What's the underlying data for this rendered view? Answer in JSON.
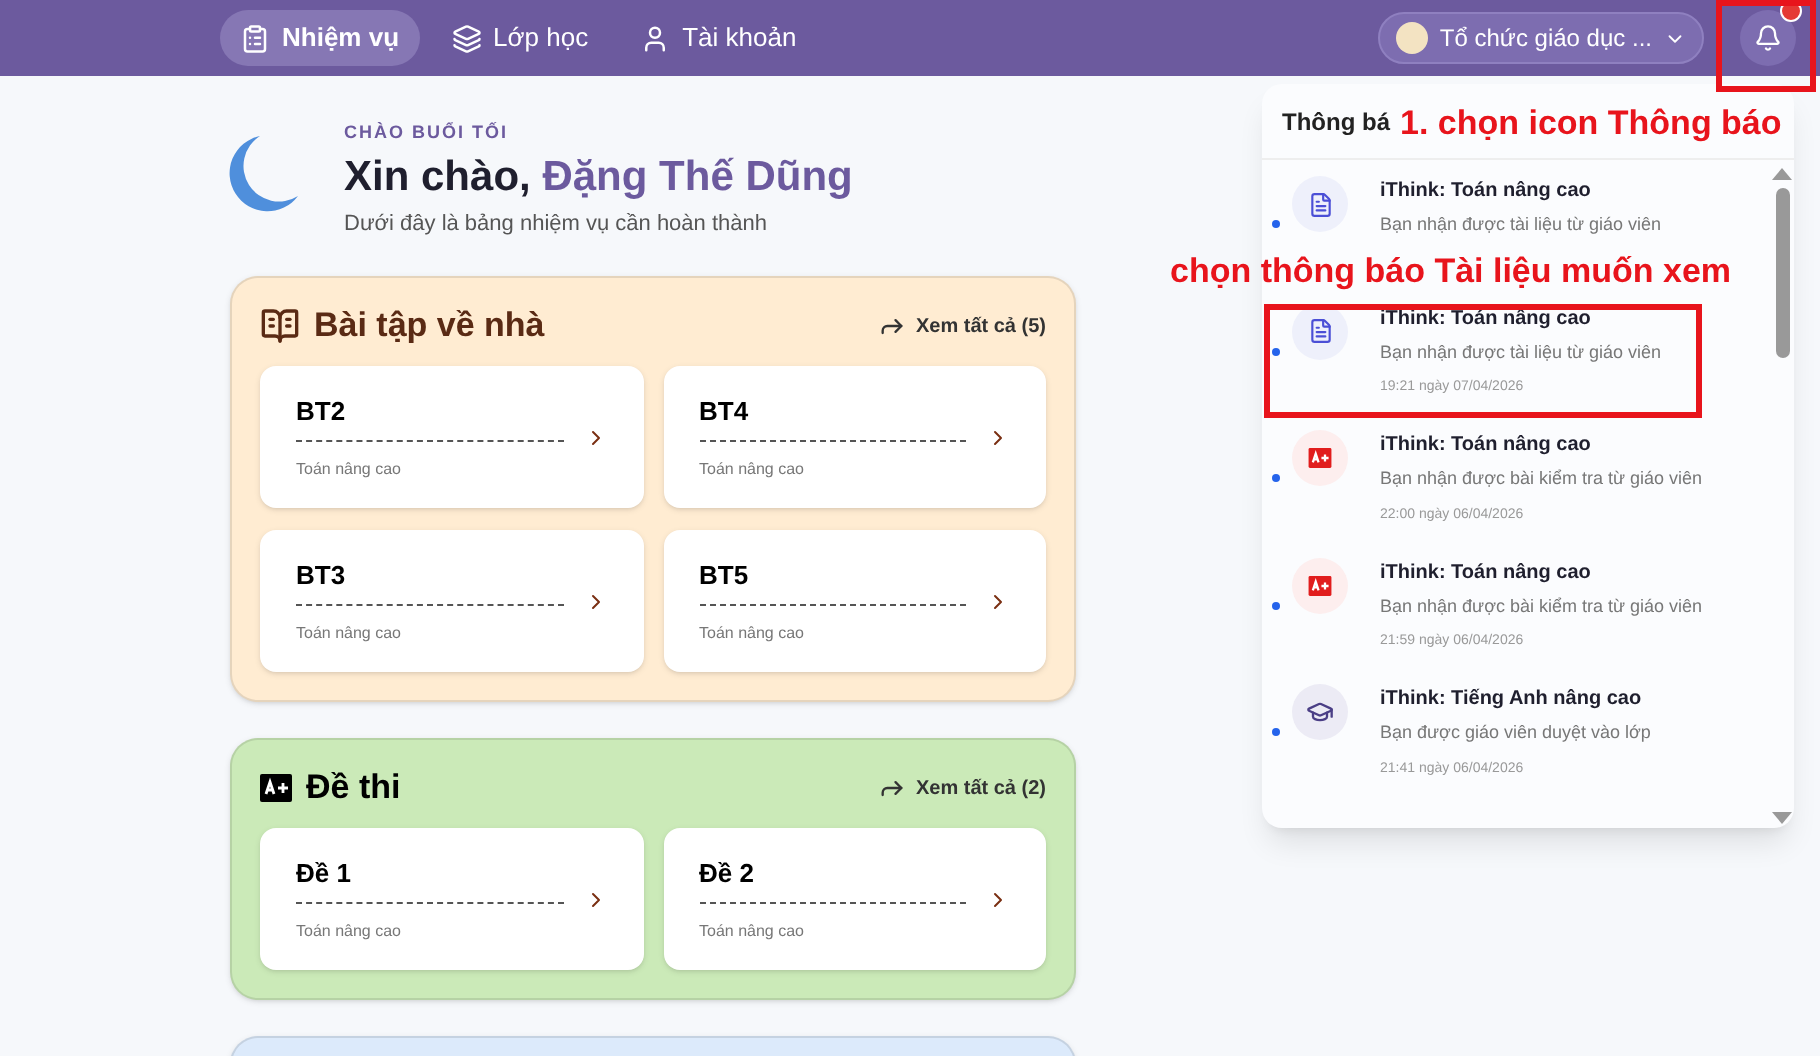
{
  "nav": {
    "items": [
      {
        "label": "Nhiệm vụ",
        "kind": "tasks",
        "selected": true
      },
      {
        "label": "Lớp học",
        "kind": "classes",
        "selected": false
      },
      {
        "label": "Tài khoản",
        "kind": "account",
        "selected": false
      }
    ],
    "org": "Tổ chức giáo dục ...",
    "unread_badge": true
  },
  "greeting": {
    "eyebrow": "CHÀO BUỔI TỐI",
    "hello": "Xin chào,",
    "name": "Đặng Thế Dũng",
    "subtitle": "Dưới đây là bảng nhiệm vụ cần hoàn thành"
  },
  "sections": [
    {
      "kind": "homework",
      "title": "Bài tập về nhà",
      "link": "Xem tất cả (5)",
      "color": "#ffecd2",
      "items": [
        {
          "title": "BT2",
          "subject": "Toán nâng cao"
        },
        {
          "title": "BT4",
          "subject": "Toán nâng cao"
        },
        {
          "title": "BT3",
          "subject": "Toán nâng cao"
        },
        {
          "title": "BT5",
          "subject": "Toán nâng cao"
        }
      ]
    },
    {
      "kind": "exam",
      "title": "Đề thi",
      "link": "Xem tất cả (2)",
      "color": "#cbeab8",
      "items": [
        {
          "title": "Đề 1",
          "subject": "Toán nâng cao"
        },
        {
          "title": "Đề 2",
          "subject": "Toán nâng cao"
        }
      ]
    },
    {
      "kind": "other",
      "color": "#dceafb"
    }
  ],
  "notifications": {
    "title": "Thông bá",
    "items": [
      {
        "kind": "document",
        "title": "iThink: Toán nâng cao",
        "body": "Bạn nhận được tài liệu từ giáo viên",
        "unread": true
      },
      {
        "kind": "document",
        "title": "iThink: Toán nâng cao",
        "body": "Bạn nhận được tài liệu từ giáo viên",
        "time": "19:21 ngày 07/04/2026",
        "unread": true
      },
      {
        "kind": "exam",
        "title": "iThink: Toán nâng cao",
        "body": "Bạn nhận được bài kiểm tra từ giáo viên",
        "time": "22:00 ngày 06/04/2026",
        "unread": true
      },
      {
        "kind": "exam",
        "title": "iThink: Toán nâng cao",
        "body": "Bạn nhận được bài kiểm tra từ giáo viên",
        "time": "21:59 ngày 06/04/2026",
        "unread": true
      },
      {
        "kind": "class",
        "title": "iThink: Tiếng Anh nâng cao",
        "body": "Bạn được giáo viên duyệt vào lớp",
        "time": "21:41 ngày 06/04/2026",
        "unread": true
      }
    ]
  },
  "annotations": [
    {
      "text": "1. chọn icon Thông báo"
    },
    {
      "text": "chọn thông báo Tài liệu muốn xem"
    }
  ]
}
